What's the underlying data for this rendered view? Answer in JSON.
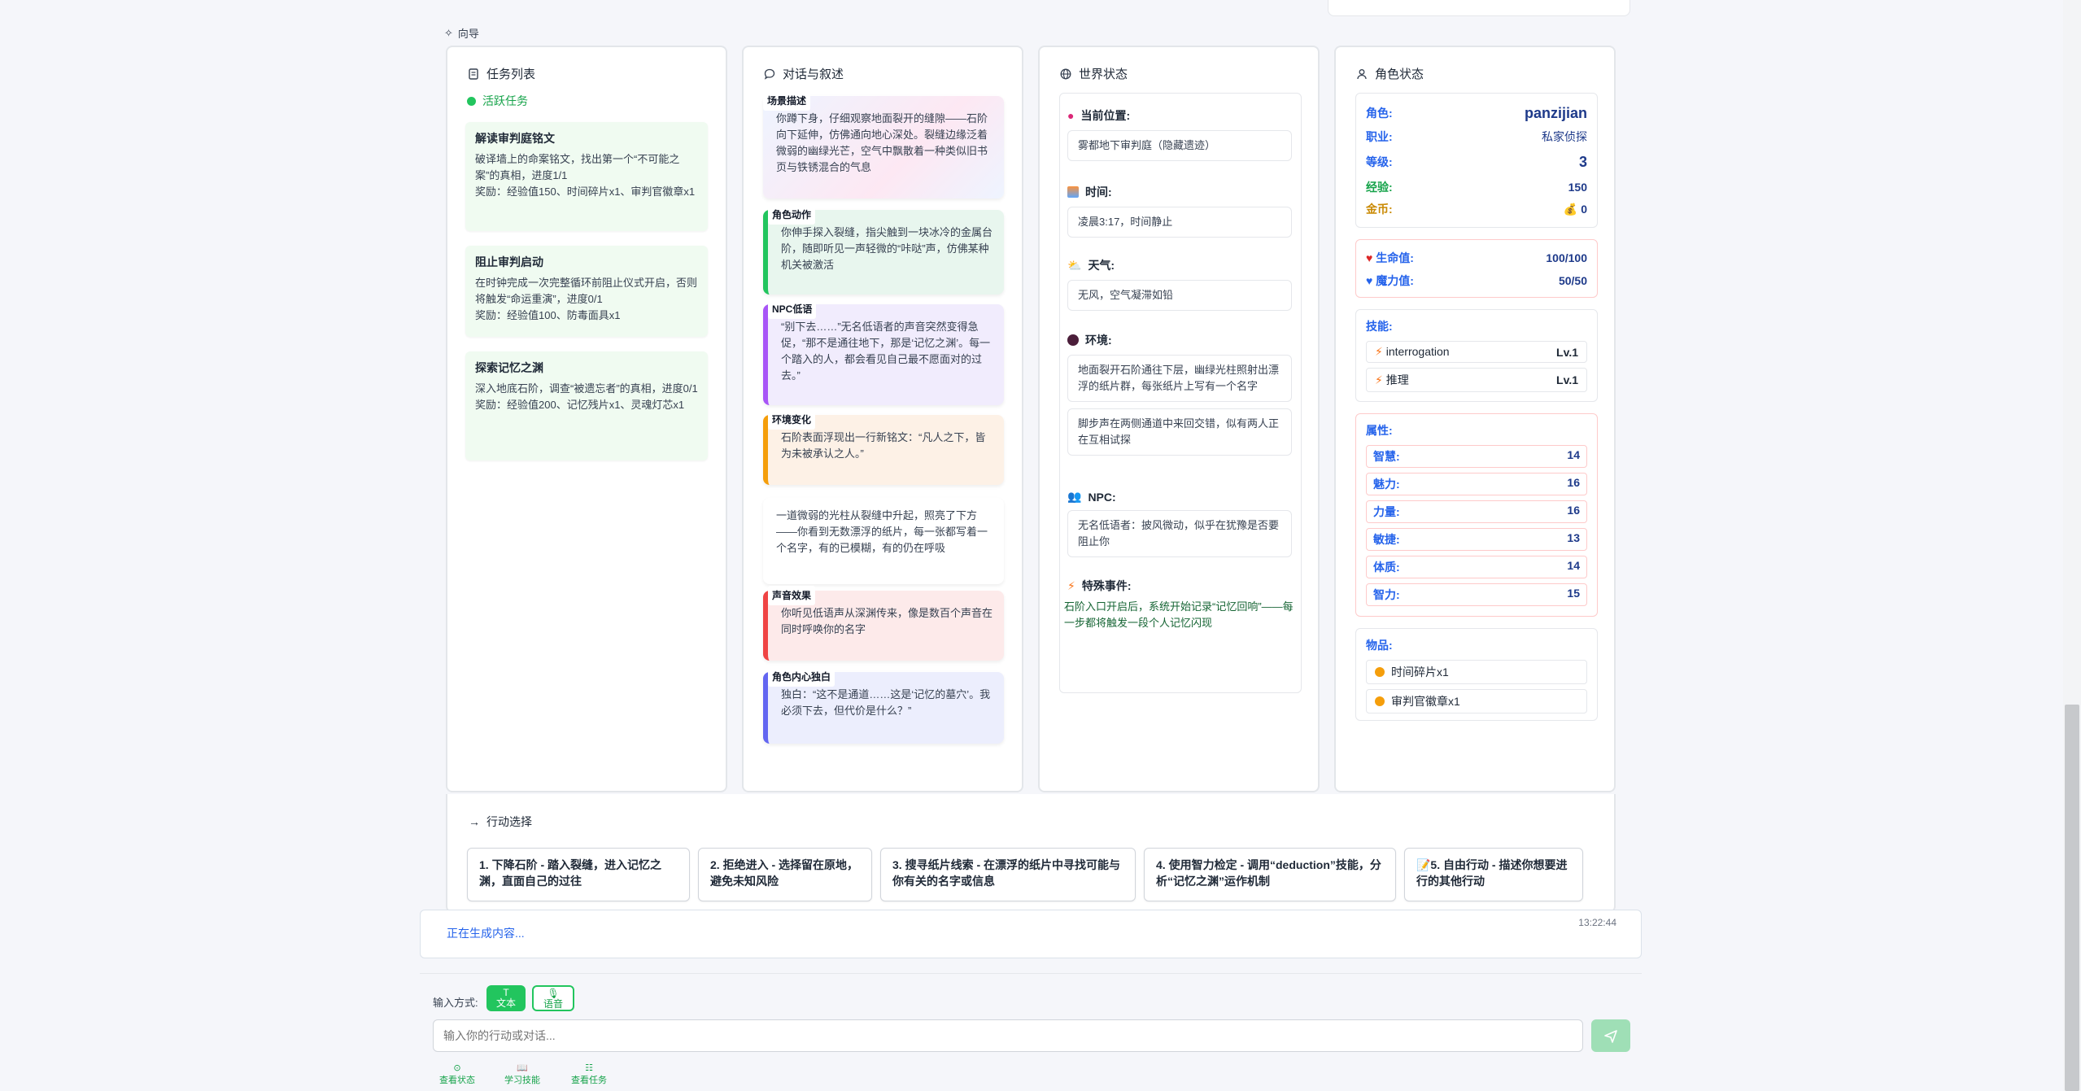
{
  "guide_label": "向导",
  "tasks": {
    "title": "任务列表",
    "active_label": "活跃任务",
    "items": [
      {
        "name": "解读审判庭铭文",
        "desc": "破译墙上的命案铭文，找出第一个“不可能之案”的真相，进度1/1",
        "reward": "奖励：经验值150、时间碎片x1、审判官徽章x1"
      },
      {
        "name": "阻止审判启动",
        "desc": "在时钟完成一次完整循环前阻止仪式开启，否则将触发“命运重演”，进度0/1",
        "reward": "奖励：经验值100、防毒面具x1"
      },
      {
        "name": "探索记忆之渊",
        "desc": "深入地底石阶，调查“被遗忘者”的真相，进度0/1",
        "reward": "奖励：经验值200、记忆残片x1、灵魂灯芯x1"
      }
    ]
  },
  "dialog": {
    "title": "对话与叙述",
    "entries": [
      {
        "tag": "场景描述",
        "text": "你蹲下身，仔细观察地面裂开的缝隙——石阶向下延伸，仿佛通向地心深处。裂缝边缘泛着微弱的幽绿光芒，空气中飘散着一种类似旧书页与铁锈混合的气息"
      },
      {
        "tag": "角色动作",
        "text": "你伸手探入裂缝，指尖触到一块冰冷的金属台阶，随即听见一声轻微的“咔哒”声，仿佛某种机关被激活"
      },
      {
        "tag": "NPC低语",
        "text": "“别下去……”无名低语者的声音突然变得急促，“那不是通往地下，那是‘记忆之渊’。每一个踏入的人，都会看见自己最不愿面对的过去。”"
      },
      {
        "tag": "环境变化",
        "text": "石阶表面浮现出一行新铭文：“凡人之下，皆为未被承认之人。”"
      },
      {
        "tag": "",
        "text": "一道微弱的光柱从裂缝中升起，照亮了下方——你看到无数漂浮的纸片，每一张都写着一个名字，有的已模糊，有的仍在呼吸"
      },
      {
        "tag": "声音效果",
        "text": "你听见低语声从深渊传来，像是数百个声音在同时呼唤你的名字"
      },
      {
        "tag": "角色内心独白",
        "text": "独白：“这不是通道……这是‘记忆的墓穴’。我必须下去，但代价是什么？”"
      }
    ]
  },
  "world": {
    "title": "世界状态",
    "location_label": "当前位置:",
    "location": "雾都地下审判庭（隐藏遗迹）",
    "time_label": "时间:",
    "time": "凌晨3:17，时间静止",
    "weather_label": "天气:",
    "weather": "无风，空气凝滞如铅",
    "env_label": "环境:",
    "env": [
      "地面裂开石阶通往下层，幽绿光柱照射出漂浮的纸片群，每张纸片上写有一个名字",
      "脚步声在两侧通道中来回交错，似有两人正在互相试探"
    ],
    "npc_label": "NPC:",
    "npc": "无名低语者：披风微动，似乎在犹豫是否要阻止你",
    "event_label": "特殊事件:",
    "event": "石阶入口开启后，系统开始记录“记忆回响”——每一步都将触发一段个人记忆闪现"
  },
  "character": {
    "title": "角色状态",
    "name_label": "角色:",
    "name": "panzijian",
    "job_label": "职业:",
    "job": "私家侦探",
    "level_label": "等级:",
    "level": "3",
    "exp_label": "经验:",
    "exp": "150",
    "gold_label": "金币:",
    "gold": "0",
    "hp_label": "生命值:",
    "hp": "100/100",
    "mp_label": "魔力值:",
    "mp": "50/50",
    "skills_label": "技能:",
    "skills": [
      {
        "name": "interrogation",
        "lv": "Lv.1"
      },
      {
        "name": "推理",
        "lv": "Lv.1"
      }
    ],
    "attrs_label": "属性:",
    "attrs": [
      {
        "k": "智慧:",
        "v": "14"
      },
      {
        "k": "魅力:",
        "v": "16"
      },
      {
        "k": "力量:",
        "v": "16"
      },
      {
        "k": "敏捷:",
        "v": "13"
      },
      {
        "k": "体质:",
        "v": "14"
      },
      {
        "k": "智力:",
        "v": "15"
      }
    ],
    "items_label": "物品:",
    "items": [
      "时间碎片x1",
      "审判官徽章x1"
    ]
  },
  "actions": {
    "title": "行动选择",
    "items": [
      "1. 下降石阶 - 踏入裂缝，进入记忆之渊，直面自己的过往",
      "2. 拒绝进入 - 选择留在原地，避免未知风险",
      "3. 搜寻纸片线索 - 在漂浮的纸片中寻找可能与你有关的名字或信息",
      "4. 使用智力检定 - 调用“deduction”技能，分析“记忆之渊”运作机制",
      "📝5. 自由行动 - 描述你想要进行的其他行动"
    ]
  },
  "status": {
    "generating": "正在生成内容...",
    "timestamp": "13:22:44"
  },
  "input": {
    "mode_label": "输入方式:",
    "text_mode": "文本",
    "voice_mode": "语音",
    "placeholder": "输入你的行动或对话...",
    "links": [
      "查看状态",
      "学习技能",
      "查看任务"
    ]
  },
  "colors": {
    "accent": "#22c55e",
    "blue_label": "#2563eb",
    "green_link": "#16a34a"
  }
}
